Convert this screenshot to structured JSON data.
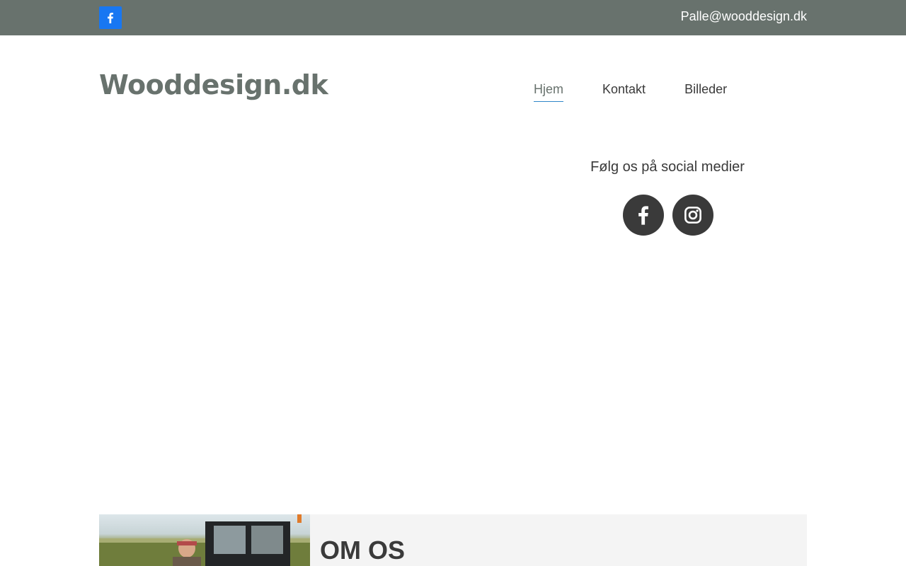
{
  "topbar": {
    "email": "Palle@wooddesign.dk",
    "facebook_icon": "facebook-icon",
    "facebook_color": "#1877f2",
    "background": "#68726d"
  },
  "header": {
    "site_title": "Wooddesign.dk",
    "nav": [
      {
        "label": "Hjem",
        "active": true
      },
      {
        "label": "Kontakt",
        "active": false
      },
      {
        "label": "Billeder",
        "active": false
      }
    ]
  },
  "social": {
    "heading": "Følg os på social medier",
    "icons": [
      "facebook-icon",
      "instagram-icon"
    ]
  },
  "about": {
    "heading": "OM OS"
  },
  "colors": {
    "accent": "#68726d",
    "text": "#3a3a3a",
    "nav_underline": "#2f86c9",
    "section_bg": "#f4f4f4"
  }
}
